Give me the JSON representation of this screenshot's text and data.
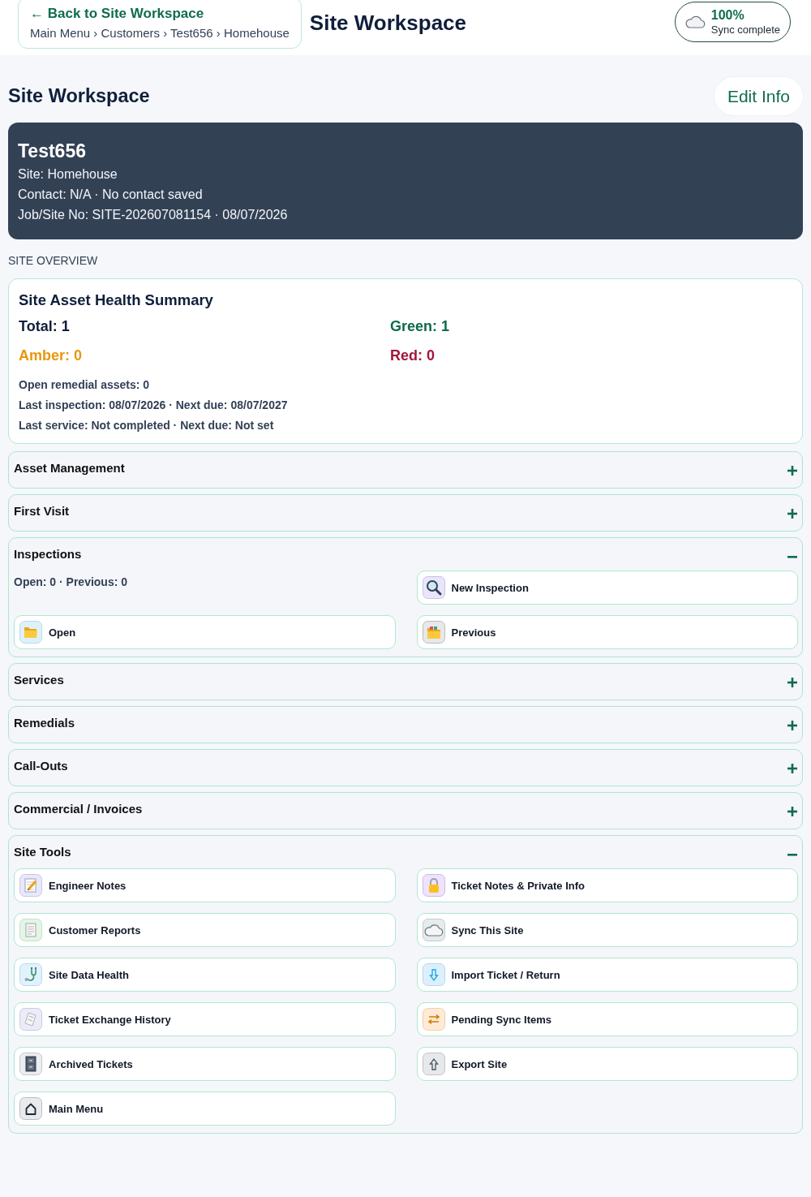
{
  "top_bar": {
    "back_link": "← Back to Site Workspace",
    "breadcrumb": "Main Menu › Customers › Test656 › Homehouse",
    "title": "Site Workspace",
    "sync": {
      "percent": "100%",
      "status": "Sync complete"
    }
  },
  "header": {
    "title": "Site Workspace",
    "edit_button": "Edit Info"
  },
  "site_card": {
    "name": "Test656",
    "lines": [
      "Site: Homehouse",
      "Contact: N/A · No contact saved",
      "Job/Site No: SITE-202607081154 · 08/07/2026"
    ]
  },
  "overview": {
    "label": "SITE OVERVIEW",
    "summary": {
      "title": "Site Asset Health Summary",
      "stats": [
        {
          "text": "Total: 1",
          "color": "#0f1f3a"
        },
        {
          "text": "Green: 1",
          "color": "#0b6b48"
        },
        {
          "text": "Amber: 0",
          "color": "#e8970c"
        },
        {
          "text": "Red: 0",
          "color": "#a3153a"
        }
      ],
      "details": [
        "Open remedial assets: 0",
        "Last inspection: 08/07/2026 · Next due: 08/07/2027",
        "Last service: Not completed · Next due: Not set"
      ]
    }
  },
  "sections": [
    {
      "title": "Asset Management",
      "expanded": false
    },
    {
      "title": "First Visit",
      "expanded": false
    },
    {
      "title": "Inspections",
      "expanded": true,
      "items": [
        {
          "kind": "text",
          "text": "Open: 0 · Previous: 0"
        },
        {
          "kind": "button",
          "label": "New Inspection"
        },
        {
          "kind": "button",
          "label": "Open"
        },
        {
          "kind": "button",
          "label": "Previous"
        }
      ]
    },
    {
      "title": "Services",
      "expanded": false
    },
    {
      "title": "Remedials",
      "expanded": false
    },
    {
      "title": "Call-Outs",
      "expanded": false
    },
    {
      "title": "Commercial / Invoices",
      "expanded": false
    },
    {
      "title": "Site Tools",
      "expanded": true,
      "items": [
        {
          "kind": "button",
          "label": "Engineer Notes"
        },
        {
          "kind": "button",
          "label": "Ticket Notes & Private Info"
        },
        {
          "kind": "button",
          "label": "Customer Reports"
        },
        {
          "kind": "button",
          "label": "Sync This Site"
        },
        {
          "kind": "button",
          "label": "Site Data Health"
        },
        {
          "kind": "button",
          "label": "Import Ticket / Return"
        },
        {
          "kind": "button",
          "label": "Ticket Exchange History"
        },
        {
          "kind": "button",
          "label": "Pending Sync Items"
        },
        {
          "kind": "button",
          "label": "Archived Tickets"
        },
        {
          "kind": "button",
          "label": "Export Site"
        },
        {
          "kind": "button",
          "label": "Main Menu"
        }
      ]
    }
  ]
}
